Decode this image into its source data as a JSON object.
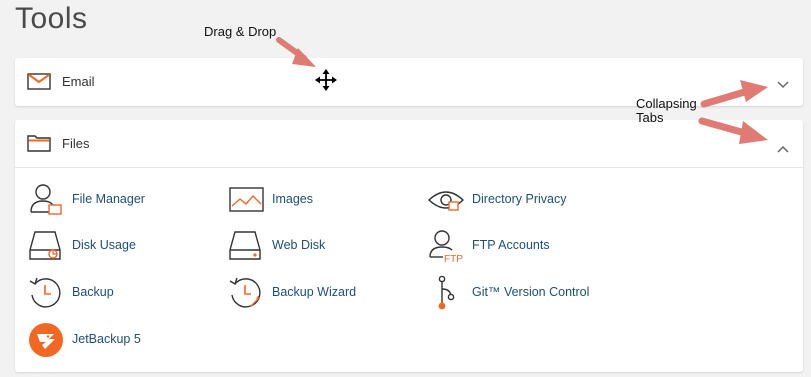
{
  "page": {
    "title": "Tools"
  },
  "annotations": {
    "drag_drop": "Drag & Drop",
    "collapsing_line1": "Collapsing",
    "collapsing_line2": "Tabs"
  },
  "colors": {
    "accent": "#f26722",
    "link": "#1f4e79",
    "arrow": "#e07b73"
  },
  "sections": {
    "email": {
      "title": "Email",
      "icon": "envelope-icon",
      "state": "collapsed"
    },
    "files": {
      "title": "Files",
      "icon": "folder-icon",
      "state": "expanded",
      "items": [
        {
          "label": "File Manager",
          "icon": "file-manager-icon"
        },
        {
          "label": "Images",
          "icon": "images-icon"
        },
        {
          "label": "Directory Privacy",
          "icon": "directory-privacy-icon"
        },
        {
          "label": "Disk Usage",
          "icon": "disk-usage-icon"
        },
        {
          "label": "Web Disk",
          "icon": "web-disk-icon"
        },
        {
          "label": "FTP Accounts",
          "icon": "ftp-accounts-icon"
        },
        {
          "label": "Backup",
          "icon": "backup-icon"
        },
        {
          "label": "Backup Wizard",
          "icon": "backup-wizard-icon"
        },
        {
          "label": "Git™ Version Control",
          "icon": "git-icon"
        },
        {
          "label": "JetBackup 5",
          "icon": "jetbackup-icon"
        }
      ]
    }
  }
}
